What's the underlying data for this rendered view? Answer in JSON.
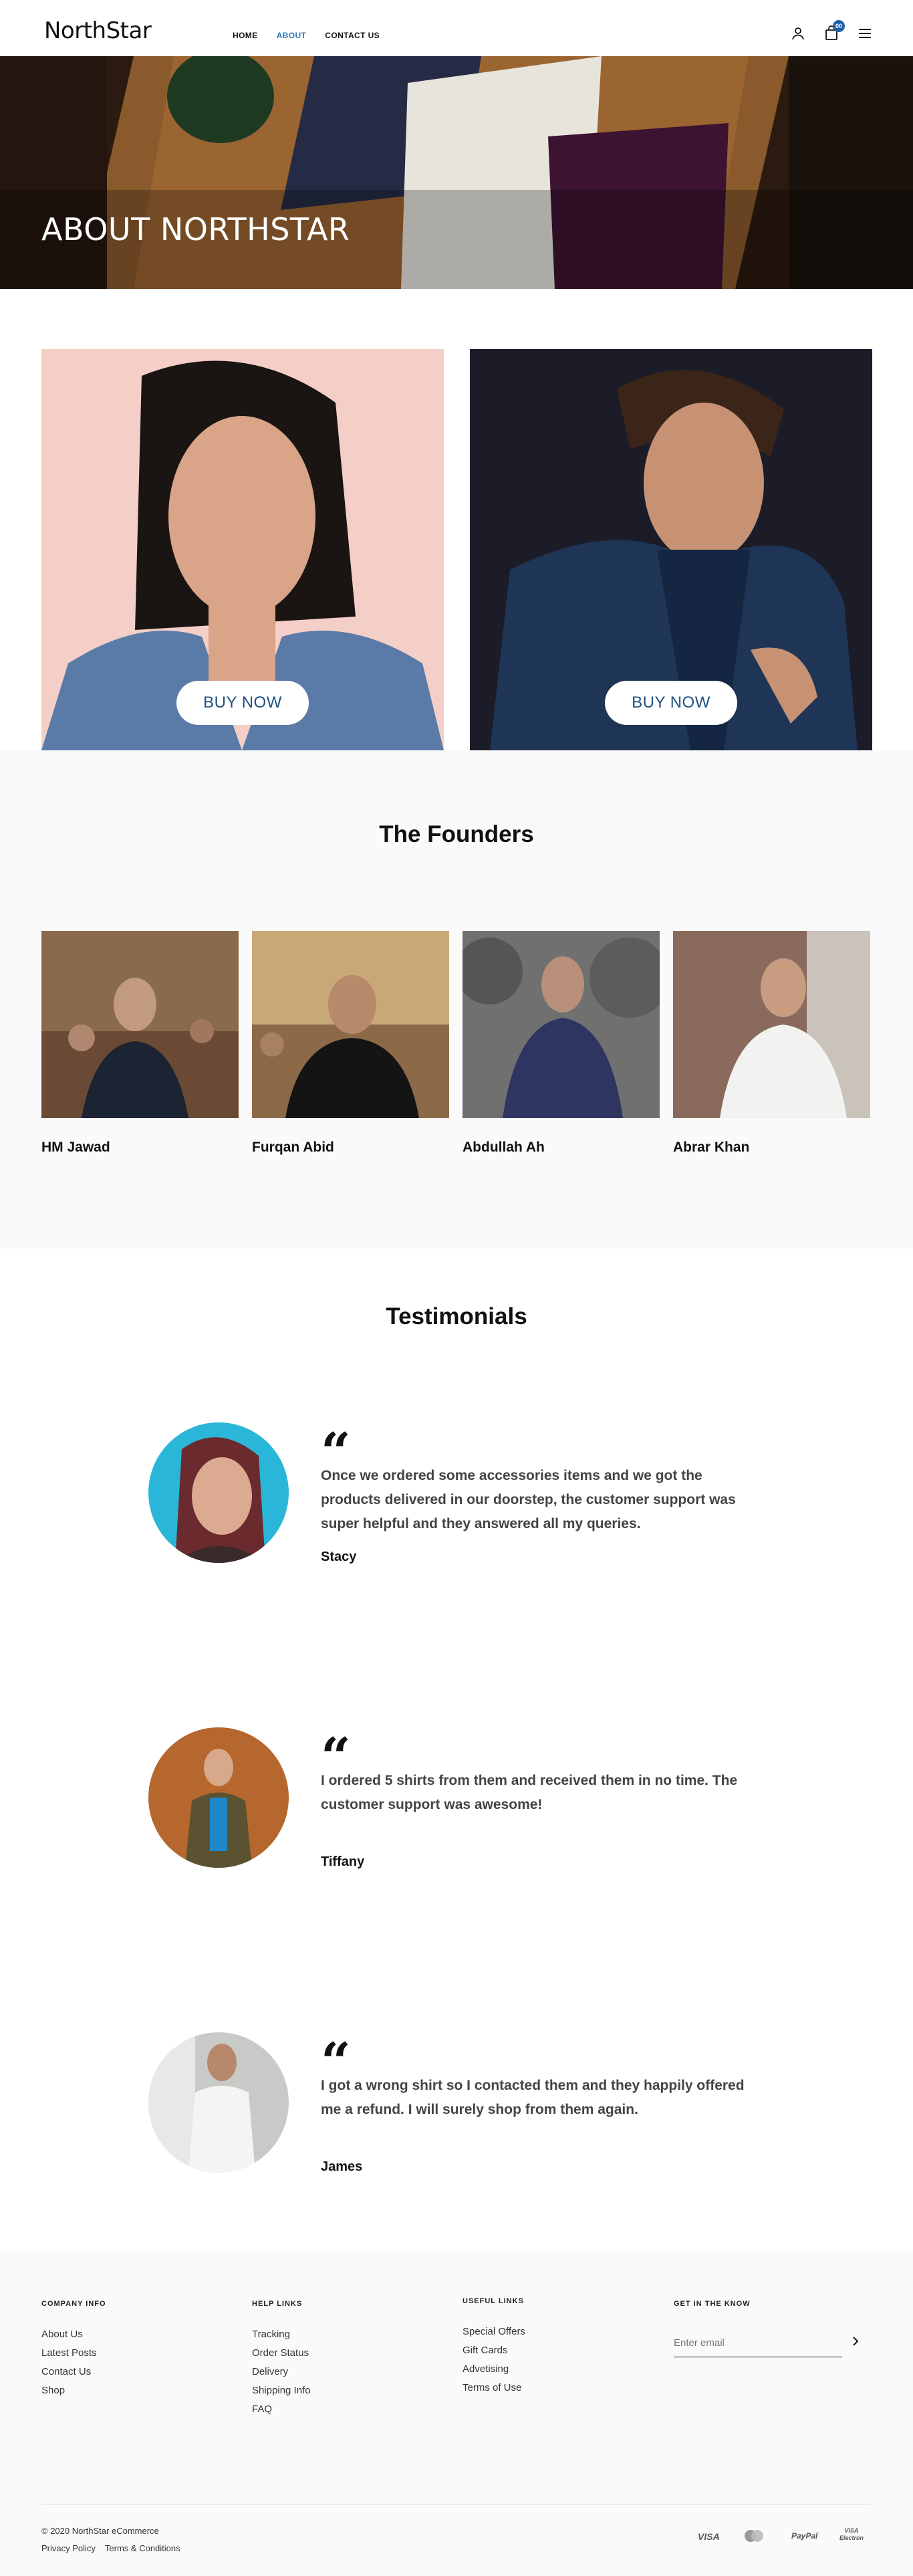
{
  "header": {
    "logo": "NorthStar",
    "nav": [
      "HOME",
      "ABOUT",
      "CONTACT US"
    ],
    "active_nav": "ABOUT",
    "cart_count": "00",
    "accent": "#2a7bbf"
  },
  "hero": {
    "title": "ABOUT NORTHSTAR"
  },
  "promo": {
    "left_button": "BUY NOW",
    "right_button": "BUY NOW"
  },
  "founders": {
    "title": "The Founders",
    "people": [
      {
        "name": "HM Jawad"
      },
      {
        "name": "Furqan Abid"
      },
      {
        "name": "Abdullah Ah"
      },
      {
        "name": "Abrar Khan"
      }
    ]
  },
  "testimonials": {
    "title": "Testimonials",
    "items": [
      {
        "quote_mark": "“",
        "text": "Once we ordered some accessories items and we got the products delivered in our doorstep, the customer support was super helpful and they answered all my queries.",
        "name": "Stacy"
      },
      {
        "quote_mark": "“",
        "text": "I ordered 5 shirts from them and received them in no time. The customer support was awesome!",
        "name": "Tiffany"
      },
      {
        "quote_mark": "“",
        "text": "I got a wrong shirt so I contacted them and they happily offered me a refund. I will surely shop from them again.",
        "name": "James"
      }
    ]
  },
  "footer": {
    "company": {
      "heading": "COMPANY INFO",
      "links": [
        "About Us",
        "Latest Posts",
        "Contact Us",
        "Shop"
      ]
    },
    "help": {
      "heading": "HELP LINKS",
      "links": [
        "Tracking",
        "Order Status",
        "Delivery",
        "Shipping Info",
        "FAQ"
      ]
    },
    "useful": {
      "heading": "USEFUL LINKS",
      "links": [
        "Special Offers",
        "Gift Cards",
        "Advetising",
        "Terms of Use"
      ]
    },
    "newsletter": {
      "heading": "GET IN THE KNOW",
      "placeholder": "Enter email"
    },
    "copyright": "© 2020 NorthStar eCommerce",
    "legal": [
      "Privacy Policy",
      "Terms & Conditions"
    ],
    "payments": [
      "VISA",
      "MasterCard",
      "PayPal",
      "VISA Electron"
    ]
  }
}
